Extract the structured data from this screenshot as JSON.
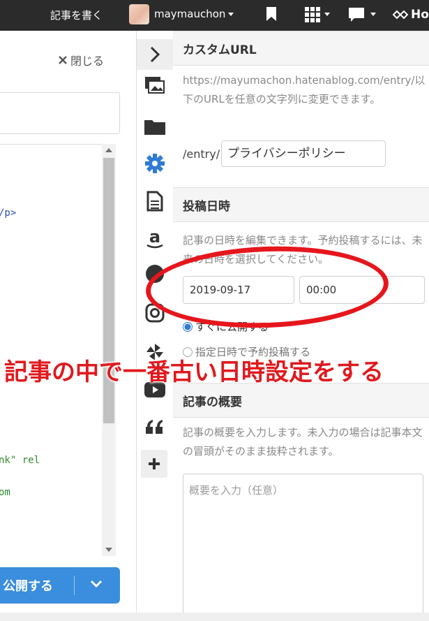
{
  "topbar": {
    "write_label": "記事を書く",
    "username": "maymauchon",
    "brand_text": "Ho"
  },
  "editor": {
    "close_label": "閉じる",
    "code_lines": [
      "/p>",
      "nk\" rel",
      "om"
    ],
    "publish_label": "公開する"
  },
  "rail": {
    "icons": [
      "chevron-right-icon",
      "images-icon",
      "folder-icon",
      "gear-icon",
      "document-icon",
      "amazon-icon",
      "circle-icon",
      "instagram-icon",
      "pinwheel-icon",
      "youtube-icon",
      "quote-icon",
      "plus-icon"
    ]
  },
  "custom_url": {
    "heading": "カスタムURL",
    "description": "https://mayumachon.hatenablog.com/entry/以下のURLを任意の文字列に変更できます。",
    "prefix": "/entry/",
    "value": "プライバシーポリシー"
  },
  "post_date": {
    "heading": "投稿日時",
    "description": "記事の日時を編集できます。予約投稿するには、未来の日時を選択してください。",
    "date": "2019-09-17",
    "time": "00:00",
    "option_now": "すぐに公開する",
    "option_schedule": "指定日時で予約投稿する"
  },
  "summary": {
    "heading": "記事の概要",
    "description": "記事の概要を入力します。未入力の場合は記事本文の冒頭がそのまま抜粋されます。",
    "placeholder": "概要を入力（任意）"
  },
  "annotation": {
    "text": "記事の中で一番古い日時設定をする",
    "color": "#e0191e"
  },
  "colors": {
    "topbar": "#2b2b2b",
    "accent": "#3b8ddd",
    "gear": "#2f7bd4"
  }
}
